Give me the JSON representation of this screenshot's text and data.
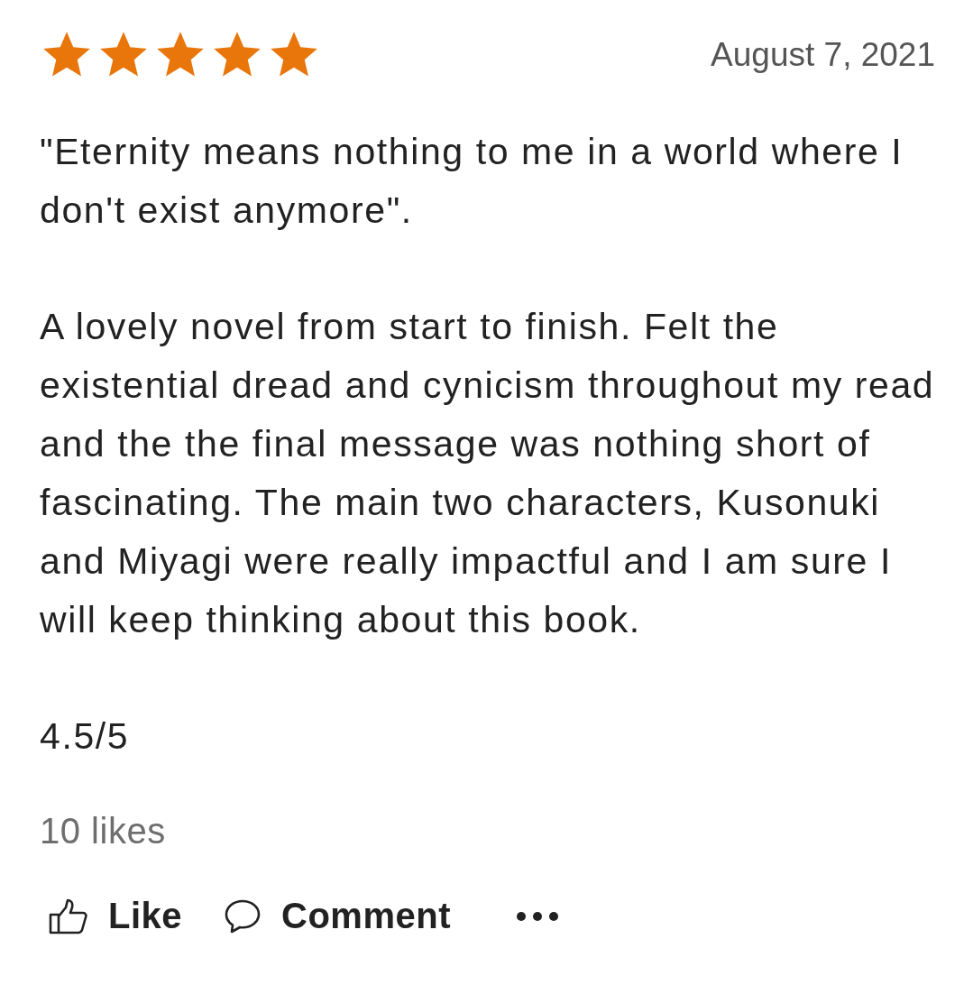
{
  "review": {
    "stars": 5,
    "date": "August 7, 2021",
    "paragraphs": [
      "\"Eternity means nothing to me in a world where I don't exist anymore\".",
      "A lovely novel from start to finish. Felt the existential dread and cynicism throughout my read and the the final message was nothing short of fascinating. The main two characters, Kusonuki and Miyagi were really impactful and I am sure I will keep thinking about this book.",
      "4.5/5"
    ],
    "likes": "10 likes",
    "actions": [
      {
        "kind": "like",
        "label": "Like"
      },
      {
        "kind": "comment",
        "label": "Comment"
      },
      {
        "kind": "more"
      }
    ]
  }
}
